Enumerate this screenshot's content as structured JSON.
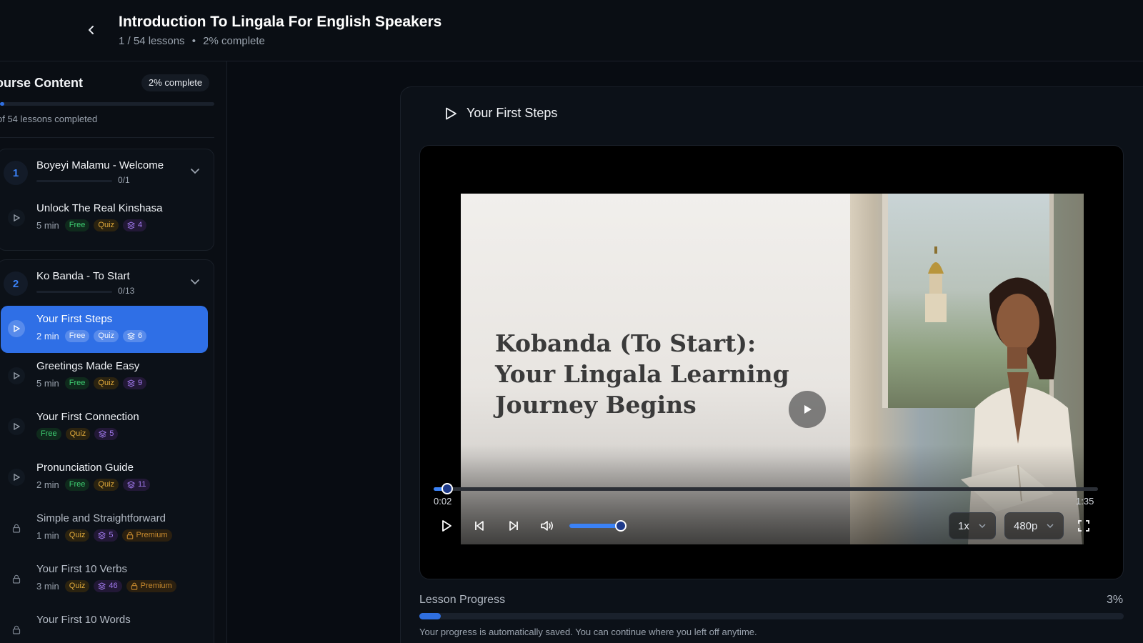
{
  "header": {
    "title": "Introduction To Lingala For English Speakers",
    "lessons_text": "1 / 54 lessons",
    "separator": "•",
    "complete_text": "2% complete",
    "back_icon": "chevron-left-icon"
  },
  "sidebar": {
    "title": "ourse Content",
    "complete_pill": "2% complete",
    "progress_pct": 2,
    "completed_text": "of 54 lessons completed",
    "modules": [
      {
        "number": "1",
        "title": "Boyeyi Malamu - Welcome",
        "count": "0/1",
        "lessons": [
          {
            "title": "Unlock The Real Kinshasa",
            "duration": "5 min",
            "free": "Free",
            "quiz": "Quiz",
            "count": "4"
          }
        ]
      },
      {
        "number": "2",
        "title": "Ko Banda - To Start",
        "count": "0/13",
        "lessons": [
          {
            "title": "Your First Steps",
            "duration": "2 min",
            "free": "Free",
            "quiz": "Quiz",
            "count": "6"
          },
          {
            "title": "Greetings Made Easy",
            "duration": "5 min",
            "free": "Free",
            "quiz": "Quiz",
            "count": "9"
          },
          {
            "title": "Your First Connection",
            "free": "Free",
            "quiz": "Quiz",
            "count": "5"
          },
          {
            "title": "Pronunciation Guide",
            "duration": "2 min",
            "free": "Free",
            "quiz": "Quiz",
            "count": "11"
          },
          {
            "title": "Simple and Straightforward",
            "duration": "1 min",
            "quiz": "Quiz",
            "count": "5",
            "premium": "Premium"
          },
          {
            "title": "Your First 10 Verbs",
            "duration": "3 min",
            "quiz": "Quiz",
            "count": "46",
            "premium": "Premium"
          },
          {
            "title": "Your First 10 Words"
          }
        ]
      }
    ]
  },
  "lesson": {
    "title": "Your First Steps",
    "slide_text": "Kobanda (To Start): Your Lingala Learning Journey Begins",
    "current_time": "0:02",
    "duration": "1:35",
    "seek_fraction": 0.02,
    "volume_fraction": 0.9,
    "speed": "1x",
    "quality": "480p",
    "progress_label": "Lesson Progress",
    "progress_pct_text": "3%",
    "progress_pct": 3,
    "autosave_note": "Your progress is automatically saved. You can continue where you left off anytime."
  },
  "colors": {
    "accent": "#2f6fe6",
    "background": "#080c12",
    "free": "#3ecf72",
    "quiz": "#e0a93a",
    "count": "#a37bf0",
    "premium": "#c88a2e"
  }
}
